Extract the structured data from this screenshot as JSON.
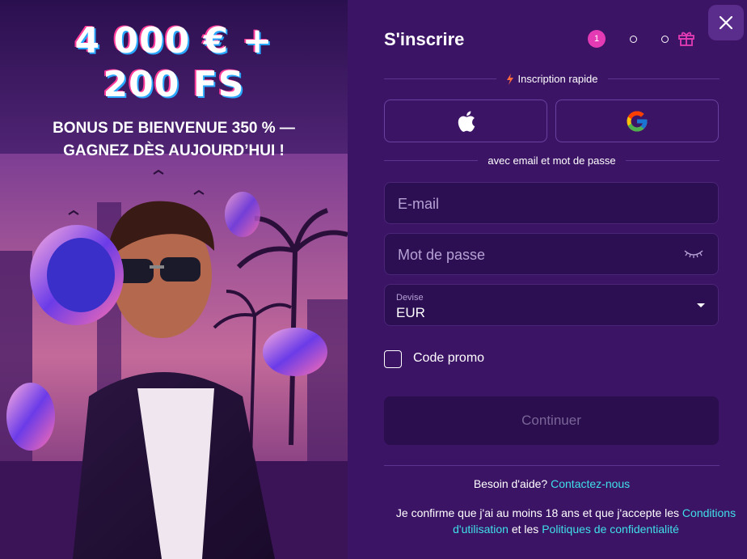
{
  "promo": {
    "headline_line1": "4 000 € +",
    "headline_line2": "200 FS",
    "subtitle_line1": "BONUS DE BIENVENUE 350 % —",
    "subtitle_line2": "GAGNEZ DÈS AUJOURD’HUI !"
  },
  "form": {
    "title": "S'inscrire",
    "step_current": "1",
    "quick_signup_label": "Inscription rapide",
    "email_password_label": "avec email et mot de passe",
    "email_placeholder": "E-mail",
    "password_placeholder": "Mot de passe",
    "currency_label": "Devise",
    "currency_value": "EUR",
    "promo_code_label": "Code promo",
    "continue_label": "Continuer"
  },
  "footer": {
    "help_text": "Besoin d'aide?",
    "help_link": "Contactez-nous",
    "terms_prefix": "Je confirme que j'ai au moins 18 ans et que j'accepte les",
    "terms_link": "Conditions d'utilisation",
    "terms_middle": "et les",
    "privacy_link": "Politiques de confidentialité"
  },
  "colors": {
    "panel_bg": "#3c1466",
    "accent_pink": "#e43bb5",
    "link_cyan": "#3fe0e8",
    "field_bg": "#2c0e52"
  },
  "icons": [
    "apple-icon",
    "google-icon",
    "gift-icon",
    "close-icon",
    "lightning-icon",
    "eye-closed-icon",
    "chevron-down-icon"
  ]
}
